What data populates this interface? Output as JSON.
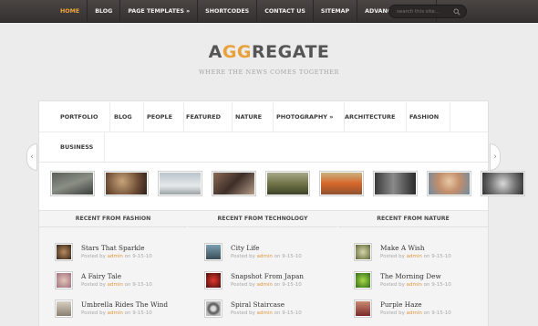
{
  "topnav": {
    "items": [
      "HOME",
      "BLOG",
      "PAGE TEMPLATES »",
      "SHORTCODES",
      "CONTACT US",
      "SITEMAP",
      "ADVANCED SEARCH"
    ],
    "search_placeholder": "search this site..."
  },
  "logo": {
    "part1": "A",
    "accent": "GG",
    "part2": "REGATE"
  },
  "tagline": "WHERE THE NEWS COMES TOGETHER",
  "categories": [
    "PORTFOLIO",
    "BLOG",
    "PEOPLE",
    "FEATURED",
    "NATURE",
    "PHOTOGRAPHY »",
    "ARCHITECTURE",
    "FASHION",
    "BUSINESS"
  ],
  "sections": [
    {
      "title": "RECENT FROM FASHION",
      "posts": [
        {
          "title": "Stars That Sparkle",
          "meta_prefix": "Posted by",
          "author": "admin",
          "date": "on 9-15-10"
        },
        {
          "title": "A Fairy Tale",
          "meta_prefix": "Posted by",
          "author": "admin",
          "date": "on 9-15-10"
        },
        {
          "title": "Umbrella Rides The Wind",
          "meta_prefix": "Posted by",
          "author": "admin",
          "date": "on 9-15-10"
        }
      ]
    },
    {
      "title": "RECENT FROM TECHNOLOGY",
      "posts": [
        {
          "title": "City Life",
          "meta_prefix": "Posted by",
          "author": "admin",
          "date": "on 9-15-10"
        },
        {
          "title": "Snapshot From Japan",
          "meta_prefix": "Posted by",
          "author": "admin",
          "date": "on 9-15-10"
        },
        {
          "title": "Spiral Staircase",
          "meta_prefix": "Posted by",
          "author": "admin",
          "date": "on 9-15-10"
        }
      ]
    },
    {
      "title": "RECENT FROM NATURE",
      "posts": [
        {
          "title": "Make A Wish",
          "meta_prefix": "Posted by",
          "author": "admin",
          "date": "on 9-15-10"
        },
        {
          "title": "The Morning Dew",
          "meta_prefix": "Posted by",
          "author": "admin",
          "date": "on 9-15-10"
        },
        {
          "title": "Purple Haze",
          "meta_prefix": "Posted by",
          "author": "admin",
          "date": "on 9-15-10"
        }
      ]
    }
  ],
  "colors": {
    "accent": "#e9a23b",
    "topbar": "#3f3a39",
    "link": "#e0953c"
  }
}
